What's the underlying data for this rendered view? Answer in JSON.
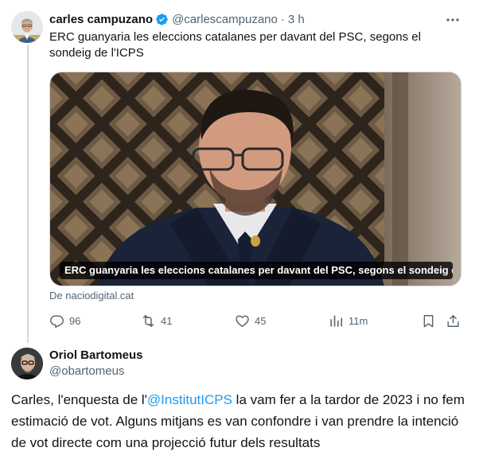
{
  "tweet1": {
    "author_name": "carles campuzano",
    "handle": "@carlescampuzano",
    "separator": "·",
    "time": "3 h",
    "text": "ERC guanyaria les eleccions catalanes per davant del PSC, segons el sondeig de l'ICPS",
    "card": {
      "caption": "ERC guanyaria les eleccions catalanes per davant del PSC, segons el sondeig de...",
      "source": "De naciodigital.cat"
    },
    "actions": {
      "replies": "96",
      "reposts": "41",
      "likes": "45",
      "views": "11m"
    }
  },
  "tweet2": {
    "author_name": "Oriol Bartomeus",
    "handle": "@obartomeus",
    "text_before": "Carles, l'enquesta de l'",
    "mention": "@InstitutICPS",
    "text_after": " la vam fer a la tardor de 2023 i no fem estimació de vot. Alguns mitjans es van confondre i van prendre la intenció de vot directe com una projecció futur dels resultats"
  },
  "colors": {
    "accent": "#1d9bf0",
    "secondary_text": "#536471",
    "primary_text": "#0f1419"
  },
  "icons": [
    "verified-badge-icon",
    "more-icon",
    "reply-icon",
    "repost-icon",
    "like-icon",
    "views-icon",
    "bookmark-icon",
    "share-icon"
  ]
}
